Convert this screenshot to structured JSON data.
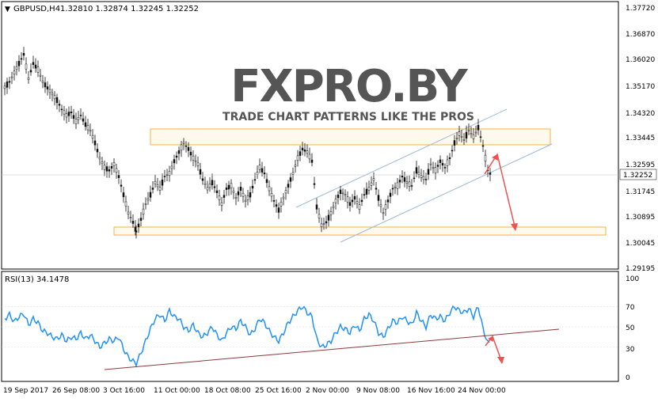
{
  "header": {
    "symbol": "GBPUSD,H4",
    "ohlc": "1.32810 1.32874 1.32245 1.32252"
  },
  "watermark": {
    "logo": "FXPRO.BY",
    "tagline": "TRADE CHART PATTERNS LIKE THE PROS"
  },
  "price_axis": {
    "labels": [
      "1.37720",
      "1.36870",
      "1.36020",
      "1.35170",
      "1.34320",
      "1.33445",
      "1.32595",
      "1.31745",
      "1.30895",
      "1.30045",
      "1.29195"
    ],
    "current_price": "1.32252"
  },
  "rsi": {
    "title": "RSI(13) 34.1478",
    "levels": [
      "100",
      "70",
      "50",
      "30",
      "0"
    ]
  },
  "time_axis": {
    "labels": [
      "19 Sep 2017",
      "26 Sep 08:00",
      "3 Oct 16:00",
      "11 Oct 00:00",
      "18 Oct 08:00",
      "25 Oct 16:00",
      "2 Nov 00:00",
      "9 Nov 08:00",
      "16 Nov 16:00",
      "24 Nov 00:00"
    ]
  },
  "colors": {
    "candle": "#111111",
    "zone": "#f5a623",
    "channel": "#9db9d6",
    "rsi_line": "#1e90ff",
    "rsi_trend": "#8b3a3a",
    "arrow": "#f05050",
    "logo_gray": "#555555",
    "logo_red": "#e23b3b"
  },
  "chart_data": [
    {
      "type": "candlestick",
      "title": "GBPUSD,H4",
      "ylim": [
        1.29195,
        1.3772
      ],
      "close_path": [
        [
          0,
          1.3512
        ],
        [
          6,
          1.353
        ],
        [
          12,
          1.356
        ],
        [
          18,
          1.359
        ],
        [
          24,
          1.362
        ],
        [
          30,
          1.354
        ],
        [
          36,
          1.359
        ],
        [
          42,
          1.357
        ],
        [
          48,
          1.353
        ],
        [
          54,
          1.351
        ],
        [
          60,
          1.349
        ],
        [
          66,
          1.347
        ],
        [
          72,
          1.344
        ],
        [
          78,
          1.342
        ],
        [
          84,
          1.343
        ],
        [
          90,
          1.34
        ],
        [
          96,
          1.342
        ],
        [
          102,
          1.339
        ],
        [
          108,
          1.337
        ],
        [
          114,
          1.333
        ],
        [
          120,
          1.328
        ],
        [
          126,
          1.325
        ],
        [
          132,
          1.324
        ],
        [
          138,
          1.326
        ],
        [
          144,
          1.322
        ],
        [
          150,
          1.316
        ],
        [
          156,
          1.31
        ],
        [
          162,
          1.307
        ],
        [
          166,
          1.304
        ],
        [
          172,
          1.308
        ],
        [
          178,
          1.313
        ],
        [
          184,
          1.316
        ],
        [
          190,
          1.32
        ],
        [
          196,
          1.318
        ],
        [
          202,
          1.322
        ],
        [
          208,
          1.323
        ],
        [
          214,
          1.327
        ],
        [
          220,
          1.33
        ],
        [
          226,
          1.333
        ],
        [
          232,
          1.331
        ],
        [
          238,
          1.328
        ],
        [
          244,
          1.326
        ],
        [
          250,
          1.321
        ],
        [
          256,
          1.318
        ],
        [
          262,
          1.32
        ],
        [
          268,
          1.317
        ],
        [
          274,
          1.313
        ],
        [
          280,
          1.318
        ],
        [
          286,
          1.319
        ],
        [
          292,
          1.315
        ],
        [
          298,
          1.318
        ],
        [
          304,
          1.314
        ],
        [
          310,
          1.316
        ],
        [
          316,
          1.321
        ],
        [
          322,
          1.325
        ],
        [
          328,
          1.323
        ],
        [
          334,
          1.318
        ],
        [
          340,
          1.314
        ],
        [
          346,
          1.311
        ],
        [
          352,
          1.315
        ],
        [
          358,
          1.319
        ],
        [
          364,
          1.323
        ],
        [
          370,
          1.328
        ],
        [
          376,
          1.331
        ],
        [
          382,
          1.33
        ],
        [
          388,
          1.327
        ],
        [
          394,
          1.312
        ],
        [
          400,
          1.306
        ],
        [
          406,
          1.307
        ],
        [
          412,
          1.31
        ],
        [
          418,
          1.314
        ],
        [
          424,
          1.317
        ],
        [
          430,
          1.316
        ],
        [
          436,
          1.313
        ],
        [
          442,
          1.315
        ],
        [
          448,
          1.312
        ],
        [
          454,
          1.316
        ],
        [
          460,
          1.318
        ],
        [
          466,
          1.321
        ],
        [
          472,
          1.315
        ],
        [
          478,
          1.31
        ],
        [
          484,
          1.314
        ],
        [
          490,
          1.318
        ],
        [
          496,
          1.319
        ],
        [
          502,
          1.322
        ],
        [
          508,
          1.32
        ],
        [
          514,
          1.319
        ],
        [
          520,
          1.324
        ],
        [
          526,
          1.322
        ],
        [
          532,
          1.321
        ],
        [
          538,
          1.326
        ],
        [
          544,
          1.324
        ],
        [
          550,
          1.327
        ],
        [
          556,
          1.325
        ],
        [
          562,
          1.328
        ],
        [
          568,
          1.333
        ],
        [
          574,
          1.336
        ],
        [
          580,
          1.334
        ],
        [
          586,
          1.337
        ],
        [
          592,
          1.335
        ],
        [
          598,
          1.338
        ],
        [
          604,
          1.332
        ],
        [
          610,
          1.324
        ],
        [
          614,
          1.3225
        ]
      ]
    },
    {
      "type": "line",
      "title": "RSI(13) 34.1478",
      "ylim": [
        0,
        100
      ],
      "y_ticks": [
        100,
        70,
        50,
        30,
        0
      ],
      "values": [
        [
          0,
          58
        ],
        [
          6,
          62
        ],
        [
          12,
          55
        ],
        [
          18,
          60
        ],
        [
          24,
          63
        ],
        [
          30,
          52
        ],
        [
          36,
          58
        ],
        [
          42,
          54
        ],
        [
          48,
          46
        ],
        [
          54,
          44
        ],
        [
          60,
          40
        ],
        [
          66,
          38
        ],
        [
          72,
          42
        ],
        [
          78,
          36
        ],
        [
          84,
          40
        ],
        [
          90,
          38
        ],
        [
          96,
          44
        ],
        [
          102,
          38
        ],
        [
          108,
          42
        ],
        [
          114,
          36
        ],
        [
          120,
          30
        ],
        [
          126,
          34
        ],
        [
          132,
          38
        ],
        [
          138,
          36
        ],
        [
          144,
          40
        ],
        [
          150,
          28
        ],
        [
          156,
          20
        ],
        [
          162,
          16
        ],
        [
          166,
          14
        ],
        [
          172,
          24
        ],
        [
          178,
          36
        ],
        [
          184,
          48
        ],
        [
          190,
          58
        ],
        [
          196,
          62
        ],
        [
          202,
          56
        ],
        [
          208,
          66
        ],
        [
          214,
          60
        ],
        [
          220,
          58
        ],
        [
          226,
          50
        ],
        [
          232,
          46
        ],
        [
          238,
          52
        ],
        [
          244,
          44
        ],
        [
          250,
          40
        ],
        [
          256,
          44
        ],
        [
          262,
          50
        ],
        [
          268,
          42
        ],
        [
          274,
          36
        ],
        [
          280,
          44
        ],
        [
          286,
          50
        ],
        [
          292,
          48
        ],
        [
          298,
          56
        ],
        [
          304,
          50
        ],
        [
          310,
          42
        ],
        [
          316,
          48
        ],
        [
          322,
          58
        ],
        [
          328,
          54
        ],
        [
          334,
          46
        ],
        [
          340,
          40
        ],
        [
          346,
          36
        ],
        [
          352,
          44
        ],
        [
          358,
          54
        ],
        [
          364,
          60
        ],
        [
          370,
          66
        ],
        [
          376,
          70
        ],
        [
          382,
          64
        ],
        [
          388,
          60
        ],
        [
          394,
          38
        ],
        [
          400,
          30
        ],
        [
          406,
          32
        ],
        [
          412,
          36
        ],
        [
          418,
          44
        ],
        [
          424,
          50
        ],
        [
          430,
          48
        ],
        [
          436,
          44
        ],
        [
          442,
          52
        ],
        [
          448,
          46
        ],
        [
          454,
          58
        ],
        [
          460,
          62
        ],
        [
          466,
          56
        ],
        [
          472,
          44
        ],
        [
          478,
          40
        ],
        [
          484,
          48
        ],
        [
          490,
          56
        ],
        [
          496,
          54
        ],
        [
          502,
          60
        ],
        [
          508,
          56
        ],
        [
          514,
          52
        ],
        [
          520,
          64
        ],
        [
          526,
          56
        ],
        [
          532,
          50
        ],
        [
          538,
          62
        ],
        [
          544,
          58
        ],
        [
          550,
          60
        ],
        [
          556,
          56
        ],
        [
          562,
          64
        ],
        [
          568,
          70
        ],
        [
          574,
          66
        ],
        [
          580,
          64
        ],
        [
          586,
          68
        ],
        [
          592,
          60
        ],
        [
          598,
          70
        ],
        [
          604,
          48
        ],
        [
          610,
          34
        ],
        [
          614,
          34
        ]
      ]
    }
  ]
}
